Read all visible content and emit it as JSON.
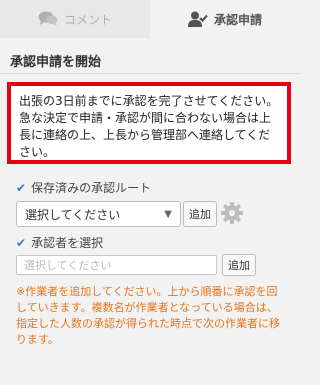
{
  "tabs": [
    {
      "label": "コメント",
      "icon": "speech-bubbles-icon",
      "active": false
    },
    {
      "label": "承認申請",
      "icon": "user-check-icon",
      "active": true
    }
  ],
  "section_title": "承認申請を開始",
  "notice": {
    "text": "出張の3日前までに承認を完了させてください。急な決定で申請・承認が間に合わない場合は上長に連絡の上、上長から管理部へ連絡してください。",
    "border_color": "#e60012"
  },
  "saved_route": {
    "label": "保存済みの承認ルート",
    "select_value": "選択してください",
    "add_label": "追加"
  },
  "approver": {
    "label": "承認者を選択",
    "placeholder": "選択してください",
    "add_label": "追加"
  },
  "hint": "※作業者を追加してください。上から順番に承認を回していきます。複数名が作業者となっている場合は、指定した人数の承認が得られた時点で次の作業者に移ります。",
  "colors": {
    "accent": "#3a78c7",
    "hint": "#e8741a",
    "alert_border": "#e60012"
  }
}
